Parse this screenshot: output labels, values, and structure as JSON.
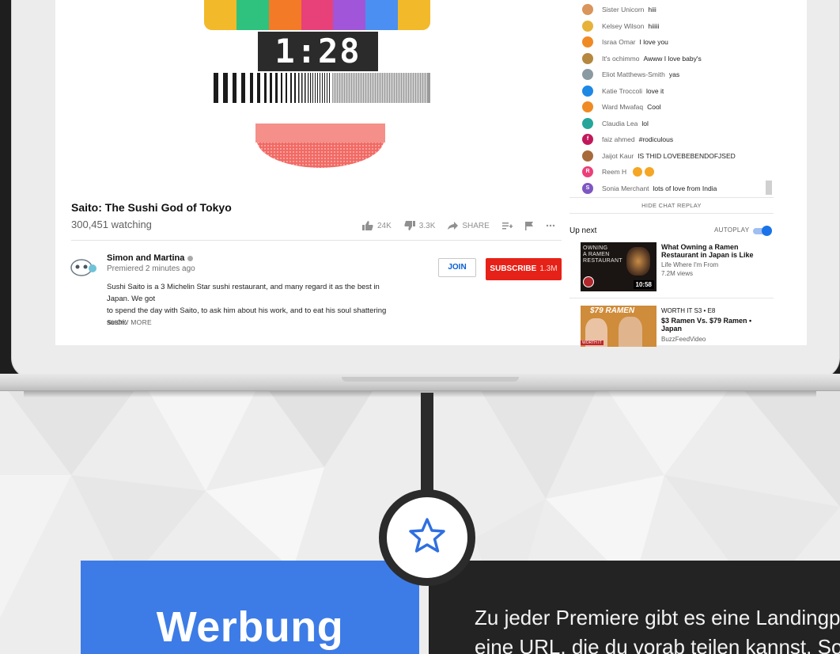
{
  "video": {
    "timer": "1:28",
    "title": "Saito: The Sushi God of Tokyo",
    "watching": "300,451 watching",
    "likes": "24K",
    "dislikes": "3.3K",
    "share_label": "SHARE",
    "test_bar_colors": [
      "#2ec27e",
      "#f37a27",
      "#e8417a",
      "#a155d8",
      "#4a8ff1",
      "#f2b92a"
    ]
  },
  "channel": {
    "name": "Simon and Martina",
    "premiered": "Premiered 2 minutes ago",
    "join_label": "JOIN",
    "subscribe_label": "SUBSCRIBE",
    "subscriber_count": "1.3M",
    "description_line1": "Sushi Saito is a 3 Michelin Star sushi restaurant, and many regard it as the best in Japan.  We got",
    "description_line2": "to spend the day with Saito, to ask him about his work, and to eat his soul shattering sushi.",
    "show_more": "SHOW MORE"
  },
  "chat": {
    "messages": [
      {
        "author": "Sister Unicorn",
        "text": "hiii",
        "color": "#d9955b"
      },
      {
        "author": "Kelsey Wilson",
        "text": "hiiiii",
        "color": "#e6b23a"
      },
      {
        "author": "Israa Omar",
        "text": "I love you",
        "color": "#f08a24"
      },
      {
        "author": "It's ochimmo",
        "text": "Awww I love baby's",
        "color": "#b5883f"
      },
      {
        "author": "Eliot Matthews-Smith",
        "text": "yas",
        "color": "#8a9aa3"
      },
      {
        "author": "Katie Troccoli",
        "text": "love it",
        "color": "#1e88e5"
      },
      {
        "author": "Ward Mwafaq",
        "text": "Cool",
        "color": "#f08a24"
      },
      {
        "author": "Claudia Lea",
        "text": "lol",
        "color": "#26a69a"
      },
      {
        "author": "faiz ahmed",
        "text": "#rodiculous",
        "color": "#c2185b",
        "initial": "f"
      },
      {
        "author": "Jaijot Kaur",
        "text": "IS THID LOVEBEBENDOFJSED",
        "color": "#a86a3a"
      },
      {
        "author": "Reem H",
        "text": "",
        "color": "#ec407a",
        "initial": "R",
        "emoji_count": 2
      },
      {
        "author": "Sonia Merchant",
        "text": "lots of love from India",
        "color": "#7e57c2",
        "initial": "S"
      }
    ],
    "hide_replay": "HIDE CHAT REPLAY"
  },
  "up_next": {
    "heading": "Up next",
    "autoplay_label": "AUTOPLAY",
    "autoplay_on": true,
    "videos": [
      {
        "thumb_text": "OWNING\nA RAMEN\nRESTAURANT",
        "duration": "10:58",
        "title": "What Owning a Ramen Restaurant in Japan is Like",
        "channel": "Life Where I'm From",
        "views": "7.2M views"
      },
      {
        "thumb_text": "$79 RAMEN",
        "thumb_tag": "WORTH IT",
        "overline": "WORTH IT  S3 • E8",
        "title": "$3 Ramen Vs. $79 Ramen • Japan",
        "channel": "BuzzFeedVideo"
      }
    ]
  },
  "feature": {
    "title": "Werbung",
    "text_line1": "Zu jeder Premiere gibt es eine Landingp",
    "text_line2": "eine URL, die du vorab teilen kannst. So",
    "accent_color": "#3d7ce6",
    "icon": "star-outline-icon"
  }
}
